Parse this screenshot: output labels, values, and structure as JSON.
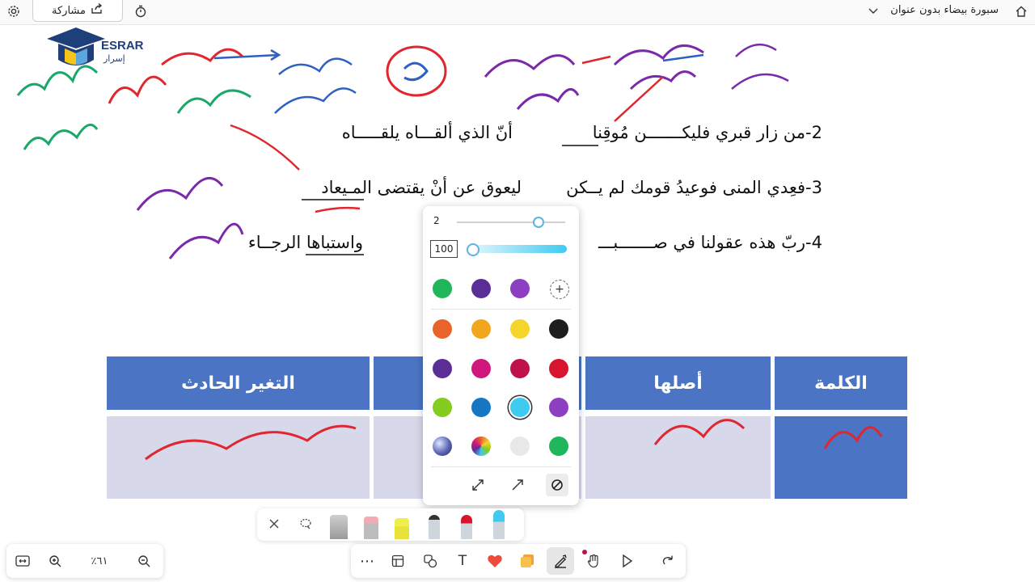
{
  "topbar": {
    "share_label": "مشاركة",
    "doc_title": "سبورة بيضاء بدون عنوان"
  },
  "logo": {
    "name": "ESRAR",
    "subtitle": "إسرار"
  },
  "lesson": {
    "line2": {
      "first": "2-من زار قبري فليكـــــــن مُوقِنا",
      "second": "أنّ الذي ألقـــاه يلقـــــاه"
    },
    "line3": {
      "first": "3-فعِدي المنى فوعيدُ قومك لم يــكن",
      "second": "ليعوق عن أنْ يقتضى المـيعاد"
    },
    "line4": {
      "first": "4-ربّ هذه عقولنا في صـــــــبـــ",
      "second": "واستباها الرجــاء"
    }
  },
  "table": {
    "headers": [
      "الكلمة",
      "أصلها",
      "",
      "التغير الحادث"
    ]
  },
  "pen_settings": {
    "size_value": "2",
    "opacity_value": "100",
    "size_fraction": 0.75,
    "opacity_fraction": 0.0,
    "colors": {
      "recent": [
        "#1fb65c",
        "#5b2d96",
        "#8d3fc2"
      ],
      "palette": [
        [
          "#e8642a",
          "#f2a61d",
          "#f5d42c",
          "#1e1e1e"
        ],
        [
          "#5b2d96",
          "#d0187c",
          "#c0124a",
          "#d8152e"
        ],
        [
          "#84cc1f",
          "#1576c4",
          "#3fcaf0",
          "#8d3fc2"
        ],
        [
          "galaxy",
          "rainbow",
          "#e8e8e8",
          "#1fb65c"
        ]
      ],
      "selected": "#3fcaf0"
    }
  },
  "toolbar": {
    "zoom_level": "٪٦١"
  },
  "colors": {
    "header_blue": "#4b74c4",
    "cell_lavender": "#d7d9ea",
    "ink_green": "#1aa86a",
    "ink_red": "#e0262f",
    "ink_purple": "#7a2aa8",
    "ink_blue": "#2e5fc4"
  }
}
